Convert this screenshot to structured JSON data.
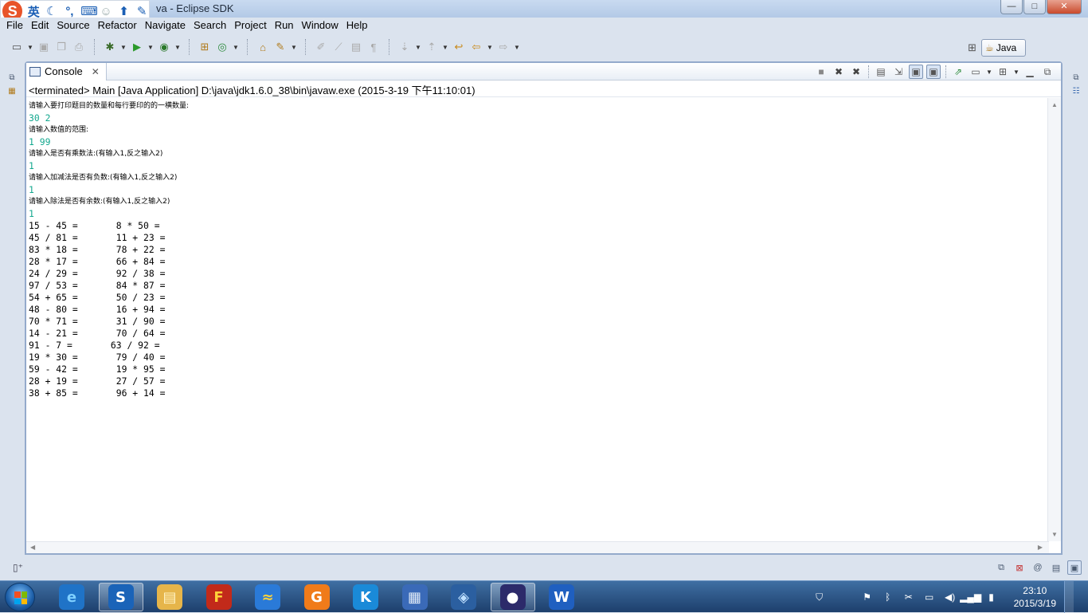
{
  "window": {
    "title": "va - Eclipse SDK",
    "minimize_label": "—",
    "maximize_label": "□",
    "close_label": "✕"
  },
  "ime": {
    "logo": "S",
    "mode": "英",
    "icons": [
      "moon-icon",
      "punctuation-icon",
      "keyboard-icon",
      "user-icon",
      "skin-icon",
      "tools-icon"
    ]
  },
  "menu": [
    "File",
    "Edit",
    "Source",
    "Refactor",
    "Navigate",
    "Search",
    "Project",
    "Run",
    "Window",
    "Help"
  ],
  "perspective": {
    "label": "Java"
  },
  "console_view": {
    "tab_label": "Console",
    "tab_close": "✕",
    "description": "<terminated> Main [Java Application] D:\\java\\jdk1.6.0_38\\bin\\javaw.exe (2015-3-19 下午11:10:01)",
    "lines": [
      {
        "kind": "prompt",
        "text": "请输入要打印题目的数量和每行要印的的一横数量:"
      },
      {
        "kind": "input",
        "text": "30 2"
      },
      {
        "kind": "prompt",
        "text": "请输入数值的范围:"
      },
      {
        "kind": "input",
        "text": "1 99"
      },
      {
        "kind": "prompt",
        "text": "请输入是否有乘数法:(有输入1,反之输入2)"
      },
      {
        "kind": "input",
        "text": "1"
      },
      {
        "kind": "prompt",
        "text": "请输入加减法是否有负数:(有输入1,反之输入2)"
      },
      {
        "kind": "input",
        "text": "1"
      },
      {
        "kind": "prompt",
        "text": "请输入除法是否有余数:(有输入1,反之输入2)"
      },
      {
        "kind": "input",
        "text": "1"
      },
      {
        "kind": "output",
        "text": "15 - 45 =       8 * 50 ="
      },
      {
        "kind": "output",
        "text": "45 / 81 =       11 + 23 ="
      },
      {
        "kind": "output",
        "text": "83 * 18 =       78 + 22 ="
      },
      {
        "kind": "output",
        "text": "28 * 17 =       66 + 84 ="
      },
      {
        "kind": "output",
        "text": "24 / 29 =       92 / 38 ="
      },
      {
        "kind": "output",
        "text": "97 / 53 =       84 * 87 ="
      },
      {
        "kind": "output",
        "text": "54 + 65 =       50 / 23 ="
      },
      {
        "kind": "output",
        "text": "48 - 80 =       16 + 94 ="
      },
      {
        "kind": "output",
        "text": "70 * 71 =       31 / 90 ="
      },
      {
        "kind": "output",
        "text": "14 - 21 =       70 / 64 ="
      },
      {
        "kind": "output",
        "text": "91 - 7 =       63 / 92 ="
      },
      {
        "kind": "output",
        "text": "19 * 30 =       79 / 40 ="
      },
      {
        "kind": "output",
        "text": "59 - 42 =       19 * 95 ="
      },
      {
        "kind": "output",
        "text": "28 + 19 =       27 / 57 ="
      },
      {
        "kind": "output",
        "text": "38 + 85 =       96 + 14 ="
      }
    ]
  },
  "colors": {
    "input_text": "#14a88f",
    "view_border": "#94aacb",
    "chrome_bg": "#dbe3ee"
  },
  "taskbar": {
    "apps": [
      {
        "name": "internet-explorer",
        "glyph": "e"
      },
      {
        "name": "sogou",
        "glyph": "S"
      },
      {
        "name": "file-explorer",
        "glyph": "▤"
      },
      {
        "name": "game-app",
        "glyph": "F"
      },
      {
        "name": "thunder",
        "glyph": "≈"
      },
      {
        "name": "pdf-reader",
        "glyph": "G"
      },
      {
        "name": "kugou",
        "glyph": "K"
      },
      {
        "name": "media-app",
        "glyph": "▦"
      },
      {
        "name": "network-app",
        "glyph": "◈"
      },
      {
        "name": "eclipse",
        "glyph": "●"
      },
      {
        "name": "wps-writer",
        "glyph": "W"
      }
    ],
    "time": "23:10",
    "date": "2015/3/19"
  }
}
